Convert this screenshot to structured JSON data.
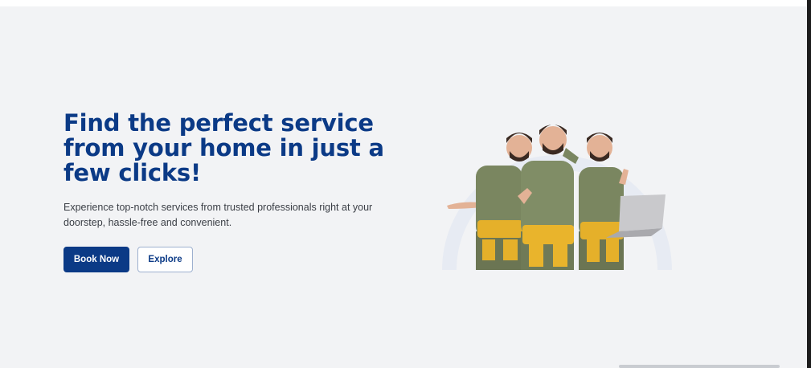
{
  "hero": {
    "headline": "Find the perfect service from your home in just a few clicks!",
    "subtext": "Experience top-notch services from trusted professionals right at your doorstep, hassle-free and convenient.",
    "primary_button": "Book Now",
    "secondary_button": "Explore"
  },
  "colors": {
    "brand": "#0b3a86",
    "hero_background": "#f2f3f5",
    "text": "#3b3f46"
  }
}
